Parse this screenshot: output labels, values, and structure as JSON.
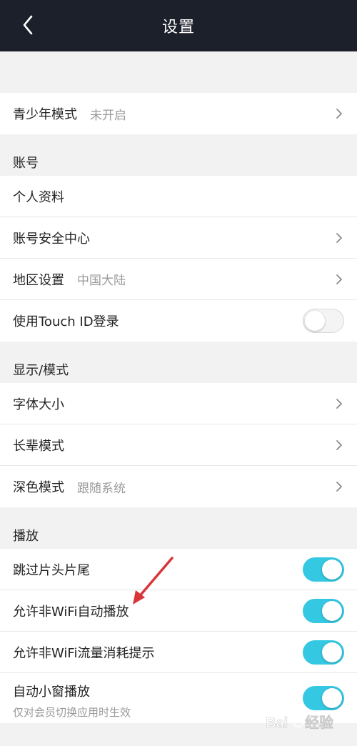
{
  "header": {
    "title": "设置"
  },
  "youth": {
    "label": "青少年模式",
    "value": "未开启"
  },
  "account": {
    "heading": "账号",
    "items": [
      {
        "label": "个人资料"
      },
      {
        "label": "账号安全中心"
      },
      {
        "label": "地区设置",
        "value": "中国大陆"
      },
      {
        "label": "使用Touch ID登录",
        "toggle": "off"
      }
    ]
  },
  "display": {
    "heading": "显示/模式",
    "items": [
      {
        "label": "字体大小"
      },
      {
        "label": "长辈模式"
      },
      {
        "label": "深色模式",
        "value": "跟随系统"
      }
    ]
  },
  "playback": {
    "heading": "播放",
    "items": [
      {
        "label": "跳过片头片尾",
        "toggle": "on"
      },
      {
        "label": "允许非WiFi自动播放",
        "toggle": "on"
      },
      {
        "label": "允许非WiFi流量消耗提示",
        "toggle": "on"
      },
      {
        "label": "自动小窗播放",
        "desc": "仅对会员切换应用时生效",
        "toggle": "on"
      }
    ]
  },
  "colors": {
    "header_bg": "#1c202b",
    "toggle_on": "#35c8e2",
    "annotation_arrow": "#d9363a"
  },
  "watermark": "Baidu 经验"
}
